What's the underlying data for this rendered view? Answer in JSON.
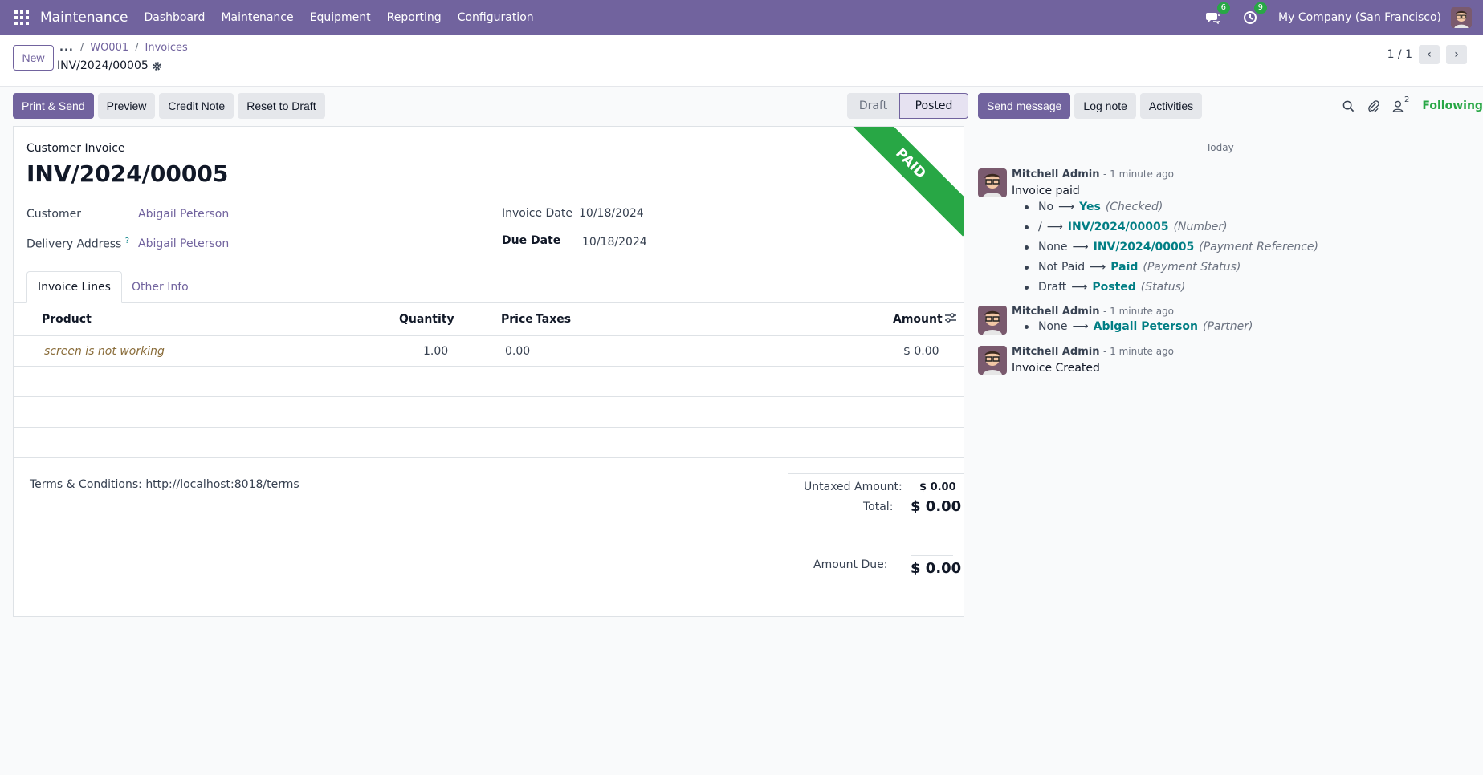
{
  "navbar": {
    "app_name": "Maintenance",
    "menu": [
      "Dashboard",
      "Maintenance",
      "Equipment",
      "Reporting",
      "Configuration"
    ],
    "messages_count": "6",
    "activities_count": "9",
    "company": "My Company (San Francisco)"
  },
  "control_panel": {
    "new_label": "New",
    "breadcrumb_dots": "...",
    "breadcrumbs": [
      "WO001",
      "Invoices"
    ],
    "record_name": "INV/2024/00005",
    "pager": "1 / 1"
  },
  "actions": {
    "print_send": "Print & Send",
    "preview": "Preview",
    "credit_note": "Credit Note",
    "reset_draft": "Reset to Draft"
  },
  "status": {
    "draft": "Draft",
    "posted": "Posted"
  },
  "form": {
    "ribbon": "PAID",
    "type": "Customer Invoice",
    "title": "INV/2024/00005",
    "customer_label": "Customer",
    "customer": "Abigail Peterson",
    "delivery_label": "Delivery Address",
    "delivery_help": "?",
    "delivery": "Abigail Peterson",
    "invoice_date_label": "Invoice Date",
    "invoice_date": "10/18/2024",
    "due_date_label": "Due Date",
    "due_date": "10/18/2024",
    "tabs": [
      "Invoice Lines",
      "Other Info"
    ],
    "columns": {
      "product": "Product",
      "quantity": "Quantity",
      "price": "Price",
      "taxes": "Taxes",
      "amount": "Amount"
    },
    "lines": [
      {
        "product": "screen is not working",
        "quantity": "1.00",
        "price": "0.00",
        "taxes": "",
        "amount": "$ 0.00"
      }
    ],
    "terms": "Terms & Conditions: http://localhost:8018/terms",
    "untaxed_label": "Untaxed Amount:",
    "untaxed": "$ 0.00",
    "total_label": "Total:",
    "total": "$ 0.00",
    "due_label": "Amount Due:",
    "due": "$ 0.00"
  },
  "chatter": {
    "send_message": "Send message",
    "log_note": "Log note",
    "activities": "Activities",
    "followers_count": "2",
    "following": "Following",
    "today": "Today",
    "messages": [
      {
        "author": "Mitchell Admin",
        "date": "- 1 minute ago",
        "body": "Invoice paid",
        "tracking": [
          {
            "old": "No",
            "new": "Yes",
            "field": "(Checked)"
          },
          {
            "old": "/",
            "new": "INV/2024/00005",
            "field": "(Number)"
          },
          {
            "old": "None",
            "new": "INV/2024/00005",
            "field": "(Payment Reference)"
          },
          {
            "old": "Not Paid",
            "new": "Paid",
            "field": "(Payment Status)"
          },
          {
            "old": "Draft",
            "new": "Posted",
            "field": "(Status)"
          }
        ]
      },
      {
        "author": "Mitchell Admin",
        "date": "- 1 minute ago",
        "tracking": [
          {
            "old": "None",
            "new": "Abigail Peterson",
            "field": "(Partner)"
          }
        ]
      },
      {
        "author": "Mitchell Admin",
        "date": "- 1 minute ago",
        "body": "Invoice Created"
      }
    ]
  },
  "colors": {
    "brand": "#71639e",
    "success": "#28a745",
    "link": "#017e84"
  }
}
